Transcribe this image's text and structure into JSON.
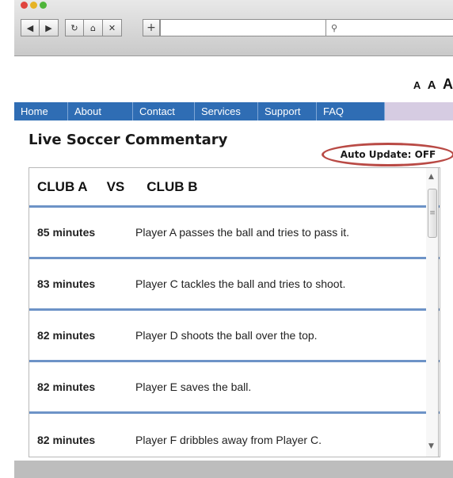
{
  "browser": {
    "nav": {
      "back_icon": "◀",
      "forward_icon": "▶",
      "reload_icon": "↻",
      "home_icon": "⌂",
      "stop_icon": "✕"
    },
    "newtab_icon": "+",
    "search_icon": "⚲"
  },
  "text_size": {
    "small": "A",
    "medium": "A",
    "large": "A"
  },
  "menu": {
    "items": [
      {
        "label": "Home"
      },
      {
        "label": "About"
      },
      {
        "label": "Contact"
      },
      {
        "label": "Services"
      },
      {
        "label": "Support"
      },
      {
        "label": "FAQ"
      }
    ]
  },
  "page": {
    "title": "Live Soccer Commentary",
    "auto_update": "Auto Update: OFF"
  },
  "match": {
    "club_a": "CLUB A",
    "vs": "VS",
    "club_b": "CLUB B"
  },
  "commentary": [
    {
      "time": "85 minutes",
      "text": "Player A passes the ball and tries to pass it."
    },
    {
      "time": "83 minutes",
      "text": "Player C tackles the ball and tries to shoot."
    },
    {
      "time": "82 minutes",
      "text": "Player D shoots the ball over the top."
    },
    {
      "time": "82 minutes",
      "text": "Player E saves the ball."
    },
    {
      "time": "82 minutes",
      "text": "Player F dribbles away from Player C."
    }
  ],
  "colors": {
    "menu_blue": "#2f6db4",
    "divider_blue": "#6d93c7",
    "highlight_red": "#b94a45"
  }
}
